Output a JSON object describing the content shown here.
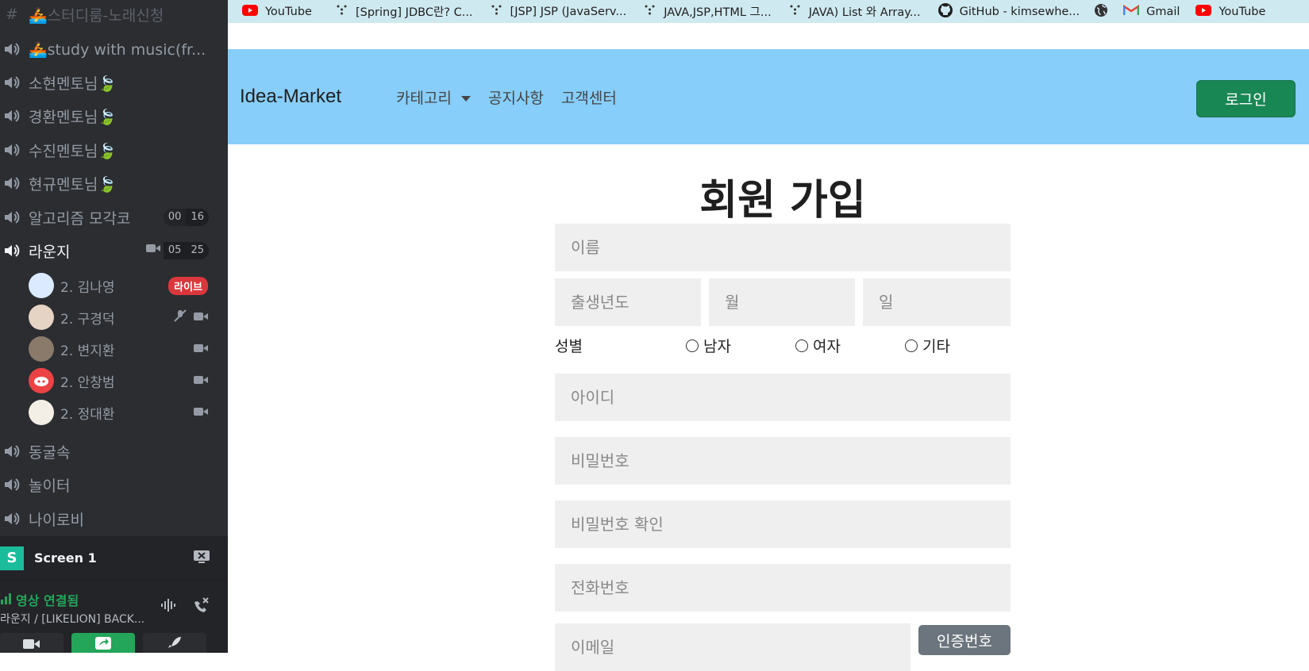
{
  "sidebar": {
    "channels": [
      {
        "label": "🚣스터디룸-노래신청",
        "type": "text"
      },
      {
        "label": "🚣study with music(fr...",
        "type": "voice"
      },
      {
        "label": "소현멘토님🍃",
        "type": "voice"
      },
      {
        "label": "경환멘토님🍃",
        "type": "voice"
      },
      {
        "label": "수진멘토님🍃",
        "type": "voice"
      },
      {
        "label": "현규멘토님🍃",
        "type": "voice"
      },
      {
        "label": "알고리즘 모각코",
        "type": "voice",
        "count_a": "00",
        "count_b": "16"
      },
      {
        "label": "라운지",
        "type": "voice",
        "count_a": "05",
        "count_b": "25"
      },
      {
        "label": "동굴속",
        "type": "voice"
      },
      {
        "label": "놀이터",
        "type": "voice"
      },
      {
        "label": "나이로비",
        "type": "voice"
      }
    ],
    "users": [
      {
        "name": "2. 김나영",
        "badge": "라이브"
      },
      {
        "name": "2. 구경덕"
      },
      {
        "name": "2. 변지환"
      },
      {
        "name": "2. 안창범"
      },
      {
        "name": "2. 정대환"
      }
    ],
    "screen": {
      "avatar_letter": "S",
      "label": "Screen 1"
    },
    "voice": {
      "status": "영상 연결됨",
      "channel": "라운지 / [LIKELION] BACK..."
    }
  },
  "bookmarks": [
    {
      "label": "YouTube",
      "icon": "youtube-icon"
    },
    {
      "label": "[Spring] JDBC란? C...",
      "icon": "velog-icon"
    },
    {
      "label": "[JSP] JSP (JavaServ...",
      "icon": "velog-icon"
    },
    {
      "label": "JAVA,JSP,HTML 그...",
      "icon": "velog-icon"
    },
    {
      "label": "JAVA) List 와 Array...",
      "icon": "velog-icon"
    },
    {
      "label": "GitHub - kimsewhe...",
      "icon": "github-icon"
    },
    {
      "label": "",
      "icon": "globe-icon"
    },
    {
      "label": "Gmail",
      "icon": "gmail-icon"
    },
    {
      "label": "YouTube",
      "icon": "youtube-icon"
    }
  ],
  "nav": {
    "brand": "Idea-Market",
    "links": [
      "카테고리",
      "공지사항",
      "고객센터"
    ],
    "login": "로그인"
  },
  "form": {
    "title": "회원 가입",
    "name_placeholder": "이름",
    "birth_year_placeholder": "출생년도",
    "birth_month_placeholder": "월",
    "birth_day_placeholder": "일",
    "gender_label": "성별",
    "gender_options": [
      "남자",
      "여자",
      "기타"
    ],
    "id_placeholder": "아이디",
    "password_placeholder": "비밀번호",
    "password_confirm_placeholder": "비밀번호 확인",
    "phone_placeholder": "전화번호",
    "email_placeholder": "이메일",
    "cert_button": "인증번호"
  },
  "colors": {
    "navbar": "#87cefa",
    "login": "#198754",
    "sidebar": "#2b2d31",
    "bookmarks_bar": "#cfe9f0"
  }
}
